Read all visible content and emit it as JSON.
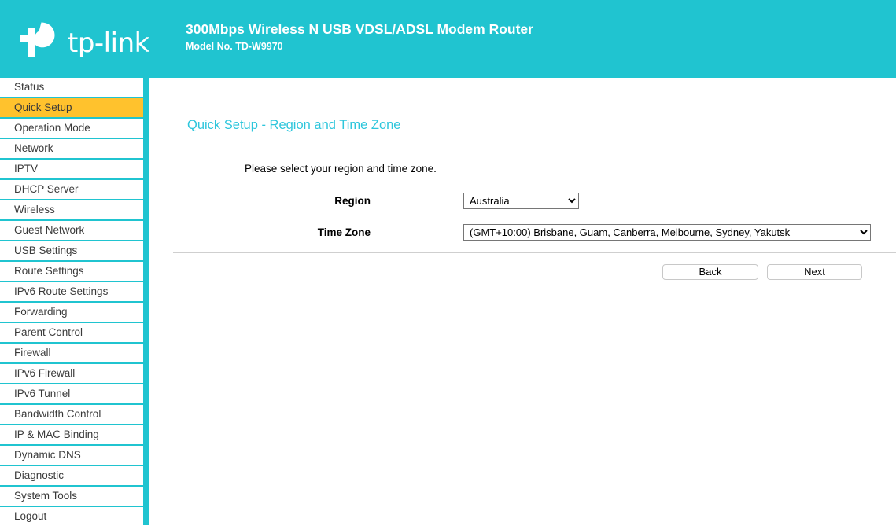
{
  "header": {
    "brand_name": "tp-link",
    "brand_icon": "tp-link-logo-icon",
    "product_title": "300Mbps Wireless N USB VDSL/ADSL Modem Router",
    "model_line": "Model No. TD-W9970",
    "background_color": "#20c4d0",
    "text_color": "#ffffff"
  },
  "sidebar": {
    "active_color": "#ffc22d",
    "items": [
      {
        "label": "Status",
        "active": false
      },
      {
        "label": "Quick Setup",
        "active": true
      },
      {
        "label": "Operation Mode",
        "active": false
      },
      {
        "label": "Network",
        "active": false
      },
      {
        "label": "IPTV",
        "active": false
      },
      {
        "label": "DHCP Server",
        "active": false
      },
      {
        "label": "Wireless",
        "active": false
      },
      {
        "label": "Guest Network",
        "active": false
      },
      {
        "label": "USB Settings",
        "active": false
      },
      {
        "label": "Route Settings",
        "active": false
      },
      {
        "label": "IPv6 Route Settings",
        "active": false
      },
      {
        "label": "Forwarding",
        "active": false
      },
      {
        "label": "Parent Control",
        "active": false
      },
      {
        "label": "Firewall",
        "active": false
      },
      {
        "label": "IPv6 Firewall",
        "active": false
      },
      {
        "label": "IPv6 Tunnel",
        "active": false
      },
      {
        "label": "Bandwidth Control",
        "active": false
      },
      {
        "label": "IP & MAC Binding",
        "active": false
      },
      {
        "label": "Dynamic DNS",
        "active": false
      },
      {
        "label": "Diagnostic",
        "active": false
      },
      {
        "label": "System Tools",
        "active": false
      },
      {
        "label": "Logout",
        "active": false
      }
    ]
  },
  "main": {
    "page_title": "Quick Setup - Region and Time Zone",
    "title_color": "#2dc6dc",
    "intro_text": "Please select your region and time zone.",
    "region": {
      "label": "Region",
      "selected": "Australia",
      "options": [
        "Australia"
      ]
    },
    "timezone": {
      "label": "Time Zone",
      "selected": "(GMT+10:00) Brisbane, Guam, Canberra, Melbourne, Sydney, Yakutsk",
      "options": [
        "(GMT+10:00) Brisbane, Guam, Canberra, Melbourne, Sydney, Yakutsk"
      ]
    },
    "buttons": {
      "back_label": "Back",
      "next_label": "Next"
    }
  }
}
